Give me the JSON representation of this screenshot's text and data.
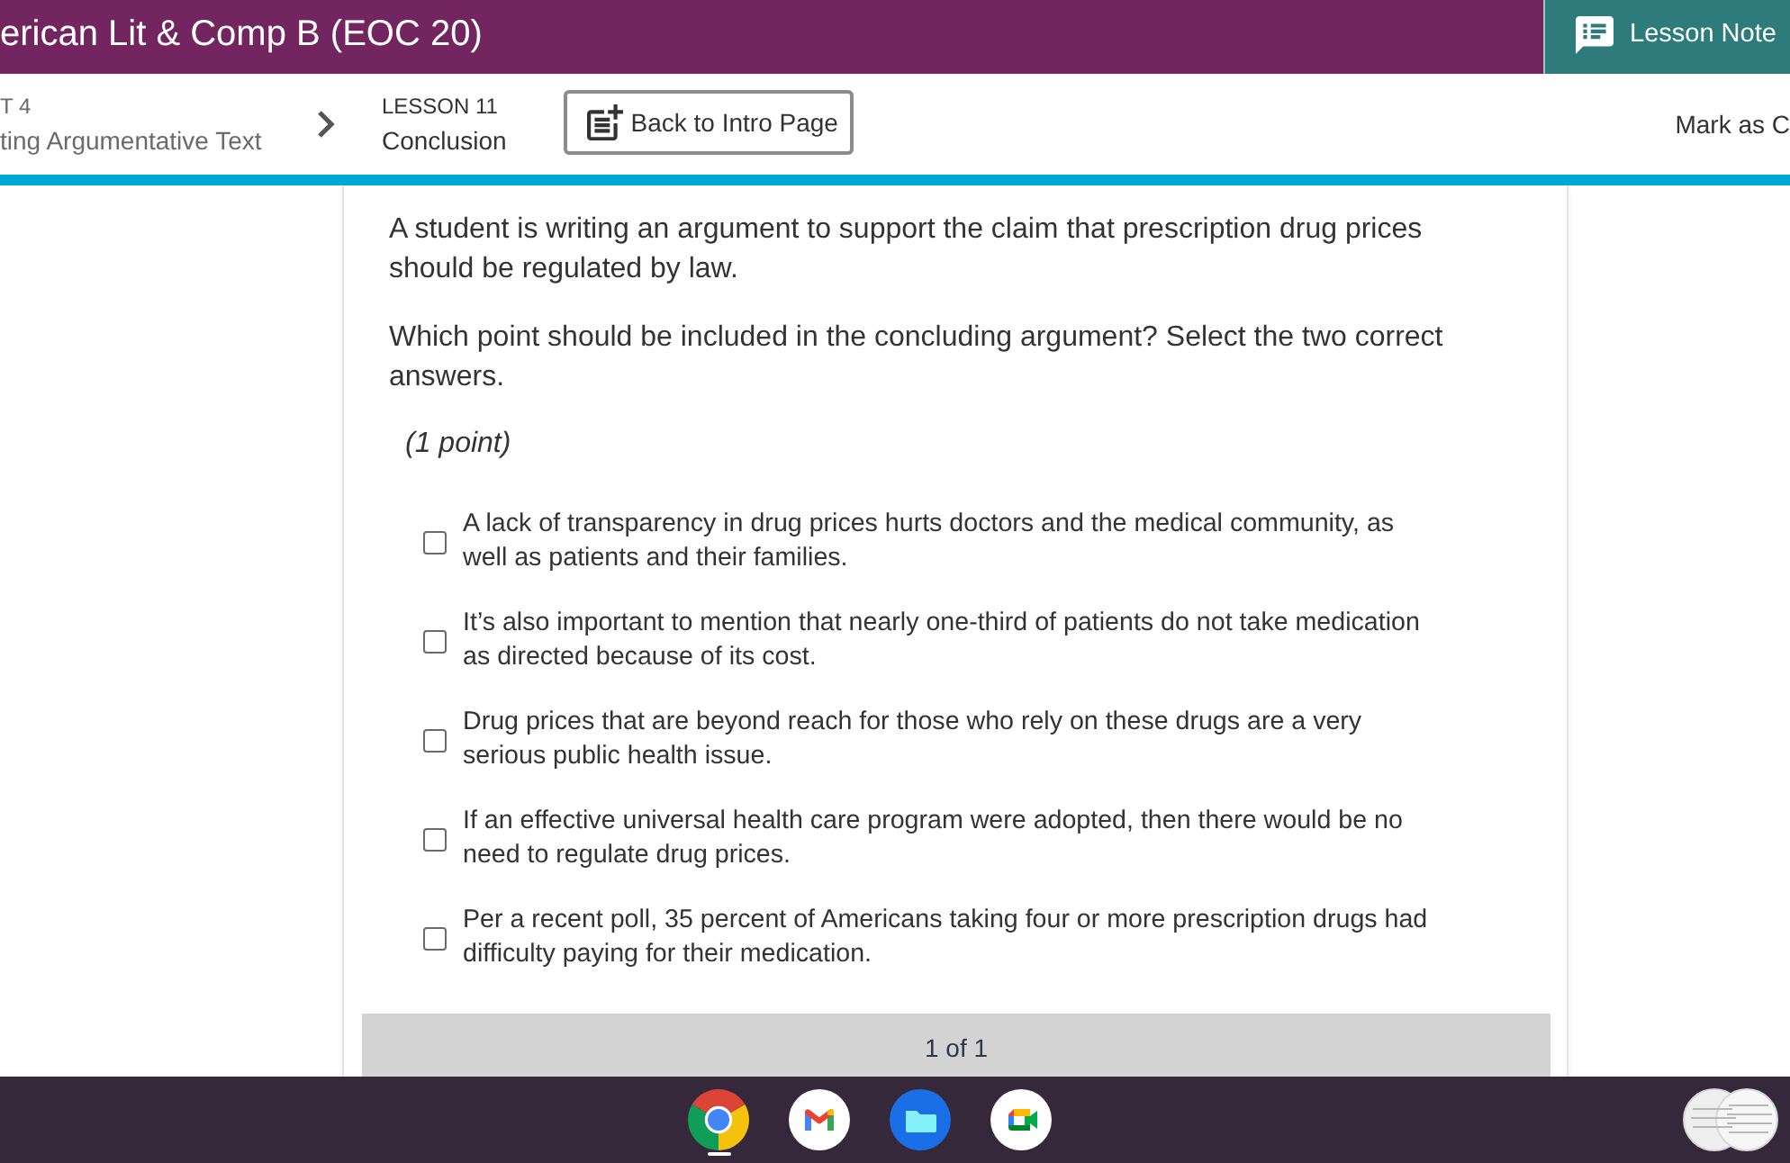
{
  "course_bar": {
    "title": "erican Lit & Comp B (EOC 20)",
    "notes_button": "Lesson Note"
  },
  "breadcrumb": {
    "unit_label": "T 4",
    "unit_title": "ting Argumentative Text",
    "lesson_label": "LESSON 11",
    "lesson_title": "Conclusion",
    "back_button": "Back to Intro Page",
    "mark_button": "Mark as C"
  },
  "question": {
    "paragraphs": [
      "A student is writing an argument to support the claim that prescription drug prices should be regulated by law.",
      "Which point should be included in the concluding argument? Select the two correct answers."
    ],
    "points": "(1 point)",
    "options": [
      {
        "text": "A lack of transparency in drug prices hurts doctors and the medical community, as well as patients and their families.",
        "checked": false
      },
      {
        "text": "It’s also important to mention that nearly one-third of patients do not take medication as directed because of its cost.",
        "checked": false
      },
      {
        "text": "Drug prices that are beyond reach for those who rely on these drugs are a very serious public health issue.",
        "checked": false
      },
      {
        "text": "If an effective universal health care program were adopted, then there would be no need to regulate drug prices.",
        "checked": false
      },
      {
        "text": "Per a recent poll, 35 percent of Americans taking four or more prescription drugs had difficulty paying for their medication.",
        "checked": false
      }
    ]
  },
  "pager": "1 of 1",
  "shelf": {
    "apps": [
      {
        "kind": "browser",
        "running": true
      },
      {
        "kind": "mail",
        "running": false
      },
      {
        "kind": "files",
        "running": false
      },
      {
        "kind": "video",
        "running": false
      }
    ]
  }
}
